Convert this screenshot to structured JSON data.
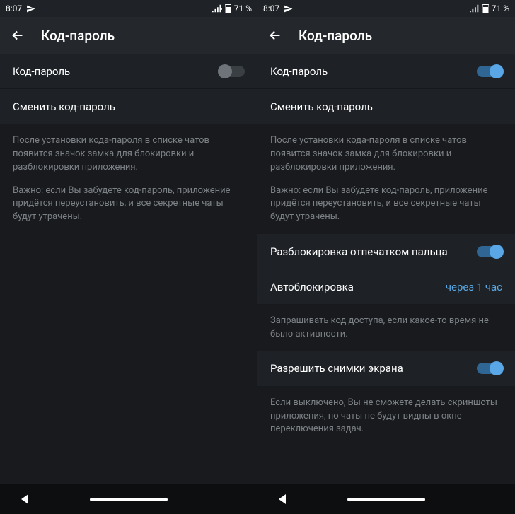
{
  "left": {
    "status": {
      "time": "8:07",
      "battery": "71 %"
    },
    "title": "Код-пароль",
    "rows": {
      "passcode": "Код-пароль",
      "change": "Сменить код-пароль"
    },
    "info": {
      "p1": "После установки кода-пароля в списке чатов появится значок замка для блокировки и разблокировки приложения.",
      "p2": "Важно: если Вы забудете код-пароль, приложение придётся переустановить, и все секретные чаты будут утрачены."
    }
  },
  "right": {
    "status": {
      "time": "8:07",
      "battery": "71 %"
    },
    "title": "Код-пароль",
    "rows": {
      "passcode": "Код-пароль",
      "change": "Сменить код-пароль",
      "fingerprint": "Разблокировка отпечатком пальца",
      "autolock_label": "Автоблокировка",
      "autolock_value": "через 1 час",
      "screenshots": "Разрешить снимки экрана"
    },
    "info": {
      "p1": "После установки кода-пароля в списке чатов появится значок замка для блокировки и разблокировки приложения.",
      "p2": "Важно: если Вы забудете код-пароль, приложение придётся переустановить, и все секретные чаты будут утрачены.",
      "autolock_hint": "Запрашивать код доступа, если какое-то время не было активности.",
      "screenshots_hint": "Если выключено, Вы не сможете делать скриншоты приложения, но чаты не будут видны в окне переключения задач."
    }
  }
}
